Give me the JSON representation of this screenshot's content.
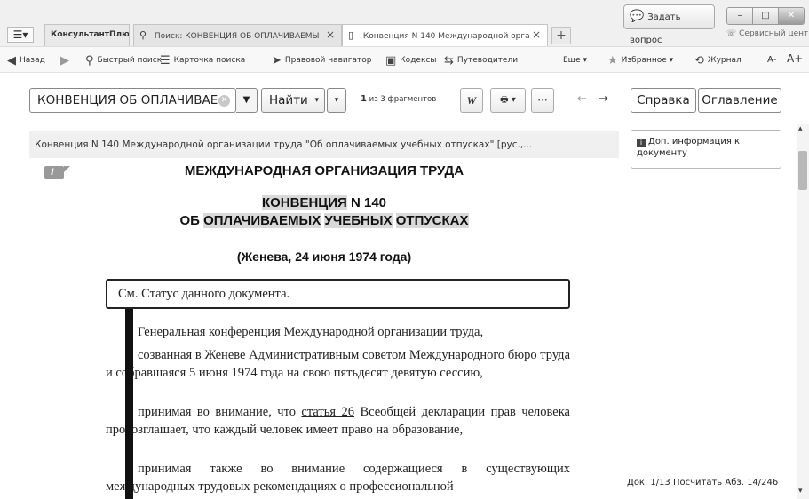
{
  "colors": {
    "accent": "#111111",
    "highlight": "#d9d9d9",
    "panel_bg": "#f0f0f0"
  },
  "titlebar": {
    "menu_icon": "menu-icon",
    "tabs": [
      {
        "label": "КонсультантПлюс"
      },
      {
        "label": "Поиск: КОНВЕНЦИЯ ОБ ОПЛАЧИВАЕМЫ",
        "icon": "search-icon",
        "close": "×"
      },
      {
        "label": "Конвенция N 140 Международной орга",
        "icon": "document-icon",
        "close": "×"
      }
    ],
    "new_tab": "+",
    "ask_question": "Задать вопрос",
    "service_center": "Сервисный центр",
    "window_buttons": [
      "–",
      "□",
      "✕"
    ]
  },
  "navbar": {
    "back": "Назад",
    "quick_search": "Быстрый поиск",
    "search_card": "Карточка поиска",
    "legal_navigator": "Правовой навигатор",
    "codes": "Кодексы",
    "guides": "Путеводители",
    "more": "Еще ▾",
    "favorites": "Избранное ▾",
    "journal": "Журнал",
    "font_smaller": "А-",
    "font_larger": "А+"
  },
  "searchbar": {
    "query": "КОНВЕНЦИЯ ОБ ОПЛАЧИВАЕ",
    "find": "Найти",
    "find_arrow": "▾",
    "prev": "▾",
    "next": "▴",
    "fragment_current": "1",
    "fragment_text": " из 3 фрагментов",
    "word_btn": "W",
    "print_btn": "🖶 ▾",
    "more_btn": "···",
    "back_arrow": "←",
    "fwd_arrow": "→"
  },
  "right_tabs": {
    "help": "Справка",
    "contents": "Оглавление"
  },
  "document": {
    "header": "Конвенция N 140 Международной организации труда \"Об оплачиваемых учебных отпусках\" [рус.,...",
    "info_icon": "i",
    "org_title": "МЕЖДУНАРОДНАЯ ОРГАНИЗАЦИЯ ТРУДА",
    "conv_word": "КОНВЕНЦИЯ",
    "conv_num": " N 140",
    "ob": "ОБ ",
    "w_paid": "ОПЛАЧИВАЕМЫХ",
    "w_study": "УЧЕБНЫХ",
    "w_leave": "ОТПУСКАХ",
    "sp": " ",
    "place_date": "(Женева, 24 июня 1974 года)",
    "status_link": "См. Статус данного документа.",
    "p1": "Генеральная конференция Международной организации труда,",
    "p2": "созванная в Женеве Административным советом Международного бюро труда и собравшаяся 5 июня 1974 года на свою пятьдесят девятую сессию,",
    "p3_before": "принимая во внимание, что ",
    "p3_link": "статья 26",
    "p3_after": " Всеобщей декларации прав человека провозглашает, что каждый человек имеет право на образование,",
    "p4": "принимая также во внимание содержащиеся в существующих международных трудовых рекомендациях о профессиональной"
  },
  "side_panel": {
    "info_title": "Доп. информация к документу",
    "status_doc": "Док. 1/13",
    "status_count": "Посчитать",
    "status_par": "Абз. 14/246"
  },
  "scrollbar": {
    "up": "▴",
    "down": "▾"
  }
}
